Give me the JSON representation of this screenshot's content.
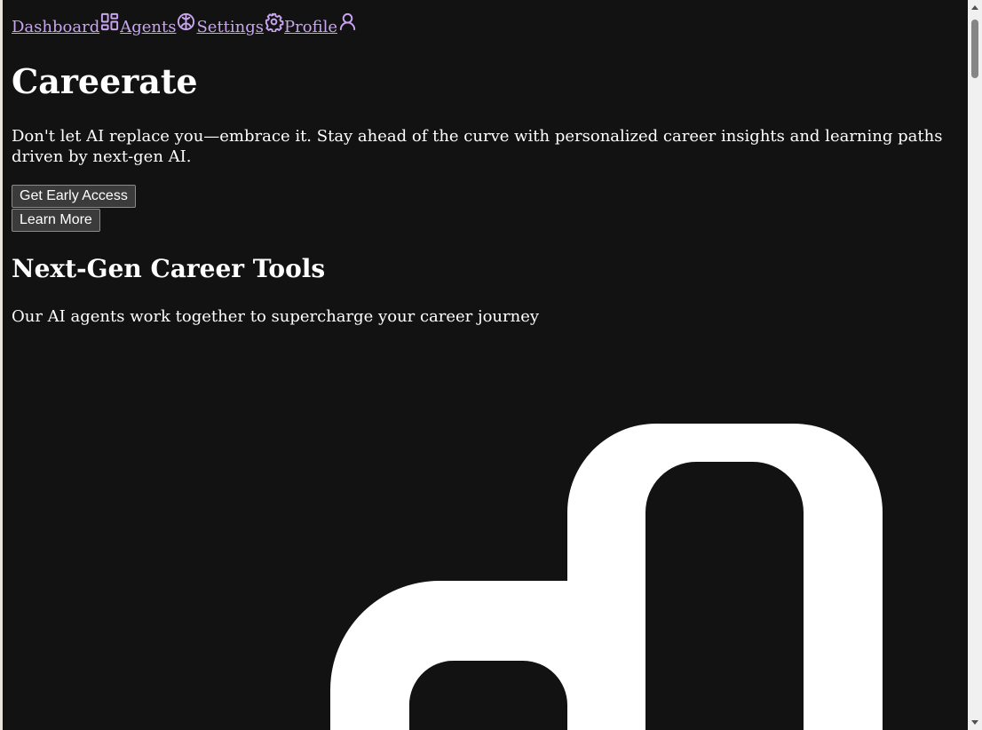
{
  "nav": {
    "items": [
      {
        "label": "Dashboard",
        "icon": "dashboard-icon"
      },
      {
        "label": "Agents",
        "icon": "brain-icon"
      },
      {
        "label": "Settings",
        "icon": "gear-icon"
      },
      {
        "label": "Profile",
        "icon": "user-icon"
      }
    ]
  },
  "hero": {
    "title": "Careerate",
    "description": "Don't let AI replace you—embrace it. Stay ahead of the curve with personalized career insights and learning paths driven by next-gen AI.",
    "primary_button": "Get Early Access",
    "secondary_button": "Learn More"
  },
  "tools": {
    "heading": "Next-Gen Career Tools",
    "subheading": "Our AI agents work together to supercharge your career journey"
  },
  "colors": {
    "background": "#121212",
    "link": "#c9a5f0",
    "text": "#ffffff"
  }
}
